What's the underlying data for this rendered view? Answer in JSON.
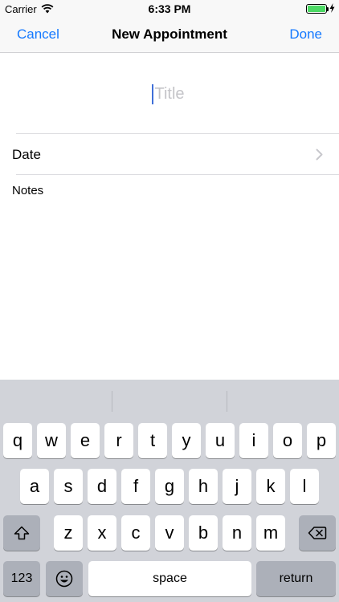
{
  "status_bar": {
    "carrier": "Carrier",
    "time": "6:33 PM",
    "battery_level": 1.0,
    "charging": true
  },
  "nav": {
    "cancel": "Cancel",
    "title": "New Appointment",
    "done": "Done"
  },
  "form": {
    "title_placeholder": "Title",
    "title_value": "",
    "date_label": "Date",
    "notes_label": "Notes"
  },
  "keyboard": {
    "row1": [
      "q",
      "w",
      "e",
      "r",
      "t",
      "y",
      "u",
      "i",
      "o",
      "p"
    ],
    "row2": [
      "a",
      "s",
      "d",
      "f",
      "g",
      "h",
      "j",
      "k",
      "l"
    ],
    "row3": [
      "z",
      "x",
      "c",
      "v",
      "b",
      "n",
      "m"
    ],
    "numbers_key": "123",
    "space_key": "space",
    "return_key": "return",
    "emoji_icon": "emoji-icon",
    "shift_icon": "shift-icon",
    "delete_icon": "delete-icon"
  },
  "colors": {
    "accent": "#1479ff",
    "placeholder": "#c4c4c8",
    "keyboard_bg": "#d1d3d9",
    "battery": "#4cd964"
  }
}
